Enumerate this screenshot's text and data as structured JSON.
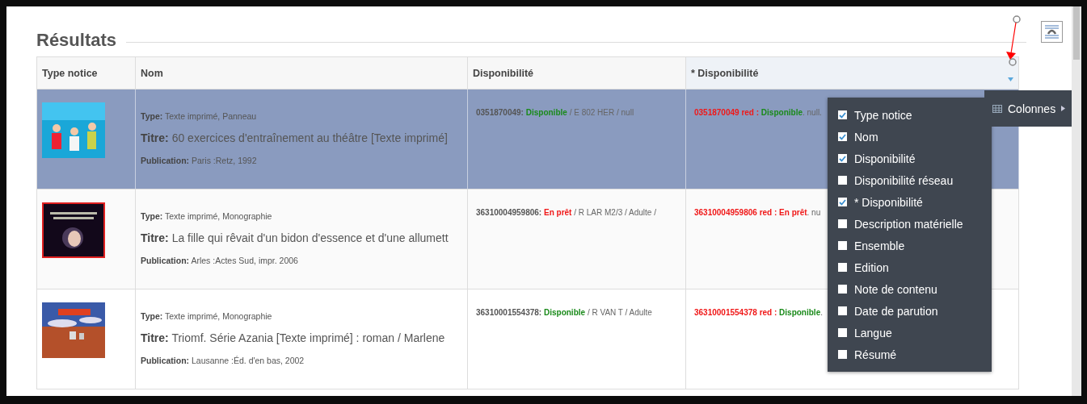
{
  "heading": "Résultats",
  "table": {
    "columns": [
      {
        "label": "Type notice",
        "sorted": false
      },
      {
        "label": "Nom",
        "sorted": false
      },
      {
        "label": "Disponibilité",
        "sorted": false
      },
      {
        "label": "* Disponibilité",
        "sorted": true
      }
    ],
    "rows": [
      {
        "selected": true,
        "type": "**Type:** Texte imprimé, Panneau",
        "title": "**Titre:** 60 exercices d'entraînement au théâtre [Texte imprimé]",
        "publication": "**Publication:** Paris :Retz, 1992",
        "availability": {
          "code": "0351870049:",
          "status": {
            "text": "Disponible",
            "color": "#1a8a1a"
          },
          "rest": "/ E 802 HER / null"
        },
        "network": {
          "code": "0351870049 red :",
          "status": {
            "text": "Disponible",
            "color": "#1a8a1a"
          },
          "rest": ". null."
        }
      },
      {
        "selected": false,
        "type": "**Type:** Texte imprimé, Monographie",
        "title": "**Titre:** La fille qui rêvait d'un bidon d'essence et d'une allumett",
        "publication": "**Publication:** Arles :Actes Sud, impr. 2006",
        "availability": {
          "code": "36310004959806:",
          "status": {
            "text": "En prêt",
            "color": "#f01818"
          },
          "rest": "/ R LAR M2/3 / Adulte /"
        },
        "network": {
          "code": "36310004959806 red :",
          "status": {
            "text": "En prêt",
            "color": "#f01818"
          },
          "rest": ". nu"
        }
      },
      {
        "selected": false,
        "type": "**Type:** Texte imprimé, Monographie",
        "title": "**Titre:** Triomf. Série Azania [Texte imprimé] : roman / Marlene",
        "publication": "**Publication:** Lausanne :Éd. d'en bas, 2002",
        "availability": {
          "code": "36310001554378:",
          "status": {
            "text": "Disponible",
            "color": "#1a8a1a"
          },
          "rest": "/ R VAN T / Adulte"
        },
        "network": {
          "code": "36310001554378 red :",
          "status": {
            "text": "Disponible",
            "color": "#1a8a1a"
          },
          "rest": "."
        }
      }
    ]
  },
  "columns_button": {
    "label": "Colonnes"
  },
  "columns_menu": [
    {
      "label": "Type notice",
      "checked": true
    },
    {
      "label": "Nom",
      "checked": true
    },
    {
      "label": "Disponibilité",
      "checked": true
    },
    {
      "label": "Disponibilité réseau",
      "checked": false
    },
    {
      "label": "* Disponibilité",
      "checked": true
    },
    {
      "label": "Description matérielle",
      "checked": false
    },
    {
      "label": "Ensemble",
      "checked": false
    },
    {
      "label": "Edition",
      "checked": false
    },
    {
      "label": "Note de contenu",
      "checked": false
    },
    {
      "label": "Date de parution",
      "checked": false
    },
    {
      "label": "Langue",
      "checked": false
    },
    {
      "label": "Résumé",
      "checked": false
    }
  ]
}
